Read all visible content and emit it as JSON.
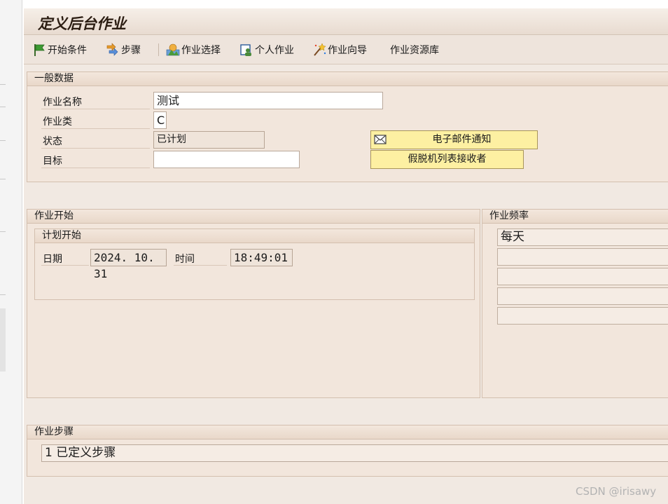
{
  "window": {
    "title": "定义后台作业"
  },
  "toolbar": {
    "items": [
      {
        "label": "开始条件",
        "icon": "flag-icon"
      },
      {
        "label": "步骤",
        "icon": "steps-icon"
      },
      {
        "label": "作业选择",
        "icon": "job-select-icon"
      },
      {
        "label": "个人作业",
        "icon": "own-jobs-icon"
      },
      {
        "label": "作业向导",
        "icon": "wizard-icon"
      },
      {
        "label": "作业资源库",
        "icon": ""
      }
    ]
  },
  "general": {
    "header": "一般数据",
    "job_name_label": "作业名称",
    "job_name_value": "测试",
    "job_class_label": "作业类",
    "job_class_value": "C",
    "status_label": "状态",
    "status_value": "已计划",
    "target_label": "目标",
    "target_value": "",
    "email_button": "电子邮件通知",
    "spool_button": "假脱机列表接收者"
  },
  "job_start": {
    "header": "作业开始",
    "sub_header": "计划开始",
    "date_label": "日期",
    "date_value": "2024. 10. 31",
    "time_label": "时间",
    "time_value": "18:49:01"
  },
  "job_frequency": {
    "header": "作业频率",
    "rows": [
      "每天",
      "",
      "",
      "",
      ""
    ]
  },
  "job_steps": {
    "header": "作业步骤",
    "value": "1 已定义步骤"
  },
  "watermark": "CSDN @irisawy",
  "colors": {
    "window_bg": "#f1e9e2",
    "button_yellow": "#fdf0a2",
    "group_border": "#d3bfae"
  }
}
